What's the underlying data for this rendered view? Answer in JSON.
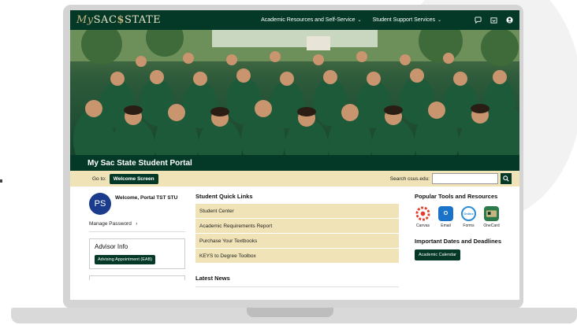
{
  "topnav": {
    "logo_my": "My",
    "logo_sac": "SAC",
    "logo_s": "$",
    "logo_state": "STATE",
    "links": [
      {
        "label": "Academic Resources and Self-Service"
      },
      {
        "label": "Student Support Services"
      }
    ],
    "icons": [
      "chat-icon",
      "inbox-icon",
      "account-icon"
    ]
  },
  "hero": {
    "title": "My Sac State Student Portal"
  },
  "gobar": {
    "goto_label": "Go to:",
    "goto_button": "Welcome Screen",
    "search_label": "Search csus.edu:",
    "search_value": ""
  },
  "left": {
    "avatar": "PS",
    "welcome": "Welcome, Portal TST STU",
    "manage_password": "Manage Password",
    "advisor_title": "Advisor Info",
    "advisor_button": "Advising Appointment (EAB)"
  },
  "middle": {
    "quick_links_title": "Student Quick Links",
    "quick_links": [
      {
        "label": "Student Center"
      },
      {
        "label": "Academic Requirements Report"
      },
      {
        "label": "Purchase Your Textbooks"
      },
      {
        "label": "KEYS to Degree Toolbox"
      }
    ],
    "news_title": "Latest News"
  },
  "right": {
    "tools_title": "Popular Tools and Resources",
    "tools": [
      {
        "label": "Canvas",
        "color": "#e13f2b"
      },
      {
        "label": "Email",
        "color": "#1a73c9"
      },
      {
        "label": "Forms",
        "color": "#ffffff"
      },
      {
        "label": "OneCard",
        "color": "#2b7a4b"
      }
    ],
    "dates_title": "Important Dates and Deadlines",
    "calendar_button": "Academic Calendar"
  },
  "colors": {
    "brand_green": "#043927",
    "brand_gold": "#f0e3b7"
  }
}
